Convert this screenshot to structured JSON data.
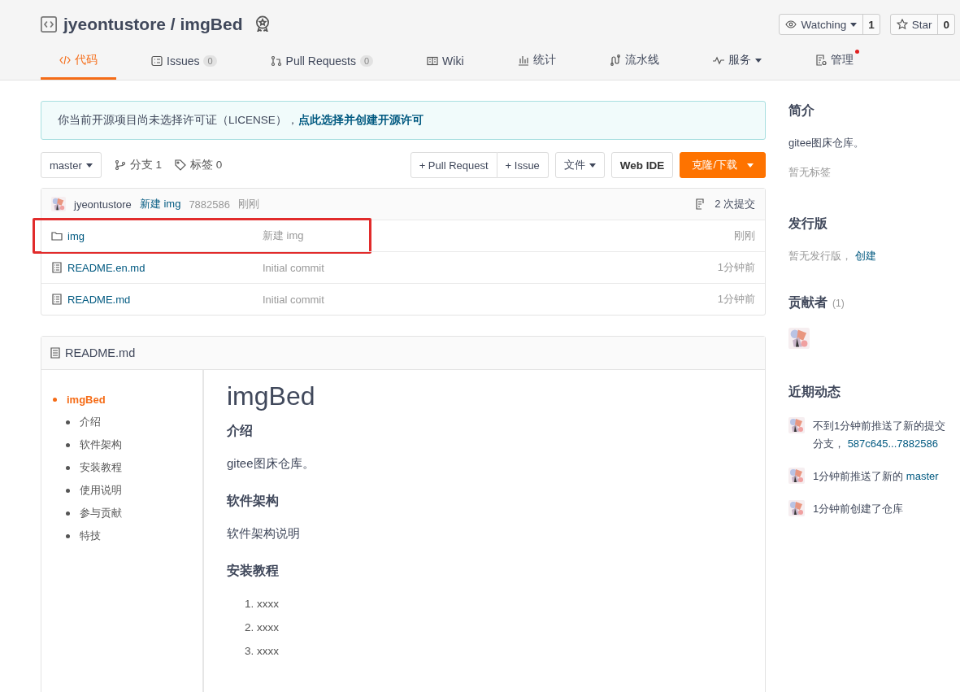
{
  "repo": {
    "title": "jyeontustore / imgBed"
  },
  "watch": {
    "label": "Watching",
    "count": "1"
  },
  "star": {
    "label": "Star",
    "count": "0"
  },
  "tabs": [
    {
      "label": "代码",
      "selected": true,
      "caret": false,
      "dot": false
    },
    {
      "label": "Issues",
      "count": "0",
      "selected": false,
      "caret": false,
      "dot": false
    },
    {
      "label": "Pull Requests",
      "count": "0",
      "selected": false,
      "caret": false,
      "dot": false
    },
    {
      "label": "Wiki",
      "selected": false,
      "caret": false,
      "dot": false
    },
    {
      "label": "统计",
      "selected": false,
      "caret": false,
      "dot": false
    },
    {
      "label": "流水线",
      "selected": false,
      "caret": false,
      "dot": false
    },
    {
      "label": "服务",
      "selected": false,
      "caret": true,
      "dot": false
    },
    {
      "label": "管理",
      "selected": false,
      "caret": false,
      "dot": true
    }
  ],
  "notice": {
    "text": "你当前开源项目尚未选择许可证（LICENSE），",
    "link": "点此选择并创建开源许可"
  },
  "toolbar": {
    "branch": "master",
    "branches": "分支 1",
    "tags": "标签 0",
    "pull_request": "+ Pull Request",
    "issue": "+ Issue",
    "file": "文件",
    "web_ide": "Web IDE",
    "clone": "克隆/下载"
  },
  "commit": {
    "author": "jyeontustore",
    "message": "新建 img",
    "hash": "7882586",
    "time": "刚刚",
    "count": "2 次提交"
  },
  "files": [
    {
      "name": "img",
      "kind": "folder",
      "message": "新建 img",
      "time": "刚刚",
      "highlighted": true
    },
    {
      "name": "README.en.md",
      "kind": "file",
      "message": "Initial commit",
      "time": "1分钟前",
      "highlighted": false
    },
    {
      "name": "README.md",
      "kind": "file",
      "message": "Initial commit",
      "time": "1分钟前",
      "highlighted": false
    }
  ],
  "readme": {
    "title": "README.md",
    "toc": [
      {
        "label": "imgBed",
        "selected": true,
        "children": [
          {
            "label": "介绍",
            "selected": false
          },
          {
            "label": "软件架构",
            "selected": false
          },
          {
            "label": "安装教程",
            "selected": false
          },
          {
            "label": "使用说明",
            "selected": false
          },
          {
            "label": "参与贡献",
            "selected": false
          },
          {
            "label": "特技",
            "selected": false
          }
        ]
      }
    ],
    "heading": "imgBed",
    "sections": [
      {
        "heading": "介绍",
        "kind": "paragraph",
        "text": "gitee图床仓库。"
      },
      {
        "heading": "软件架构",
        "kind": "paragraph",
        "text": "软件架构说明"
      },
      {
        "heading": "安装教程",
        "kind": "list",
        "items": [
          {
            "marker": "1.",
            "text": "xxxx"
          },
          {
            "marker": "2.",
            "text": "xxxx"
          },
          {
            "marker": "3.",
            "text": "xxxx"
          }
        ]
      }
    ]
  },
  "sidebar": {
    "intro": {
      "heading": "简介",
      "description": "gitee图床仓库。",
      "tags": "暂无标签"
    },
    "releases": {
      "heading": "发行版",
      "text": "暂无发行版，",
      "link": "创建"
    },
    "contributors": {
      "heading": "贡献者",
      "count": "(1)"
    },
    "activity": {
      "heading": "近期动态",
      "items": [
        {
          "lines": [
            [
              {
                "text": "不到1分钟前推送了新的提交",
                "link": false
              }
            ],
            [
              {
                "text": "分支，",
                "link": false
              },
              {
                "text": "587c645...7882586",
                "link": true
              }
            ]
          ]
        },
        {
          "lines": [
            [
              {
                "text": "1分钟前推送了新的",
                "link": false
              },
              {
                "text": "master",
                "link": true
              }
            ]
          ]
        },
        {
          "lines": [
            [
              {
                "text": "1分钟前创建了仓库",
                "link": false
              }
            ]
          ]
        }
      ]
    }
  }
}
